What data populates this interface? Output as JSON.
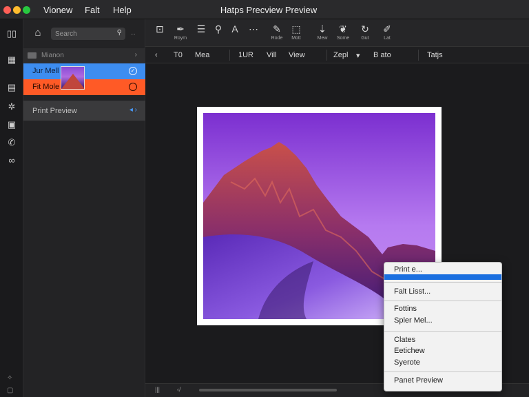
{
  "window": {
    "title": "Hatps Precview Preview",
    "menus": [
      "Vionew",
      "Falt",
      "Help"
    ]
  },
  "sidebar": {
    "search_placeholder": "Search",
    "more_glyph": "‥",
    "header_label": "Mianon",
    "items": [
      {
        "label": "Jur Mell",
        "state": "selected"
      },
      {
        "label": "Fit Mole",
        "state": "unchecked"
      },
      {
        "label": "Print Preview",
        "state": "normal"
      }
    ]
  },
  "toolbar": {
    "buttons": [
      {
        "icon": "crop-icon",
        "label": ""
      },
      {
        "icon": "pen-icon",
        "label": "Roym"
      },
      {
        "icon": "list-icon",
        "label": ""
      },
      {
        "icon": "magnify-icon",
        "label": ""
      },
      {
        "icon": "text-icon",
        "label": ""
      },
      {
        "icon": "more-icon",
        "label": ""
      },
      {
        "icon": "pencil-icon",
        "label": "Rode"
      },
      {
        "icon": "shape-icon",
        "label": "Mott"
      },
      {
        "icon": "pin-icon",
        "label": "Mew"
      },
      {
        "icon": "feather-icon",
        "label": "Some"
      },
      {
        "icon": "rotate-icon",
        "label": "Gut"
      },
      {
        "icon": "markup-icon",
        "label": "Lat"
      }
    ]
  },
  "tabs": [
    "T0",
    "Mea",
    "1UR",
    "Vill",
    "View",
    "Zepl",
    "B ato",
    "Tatjs"
  ],
  "bottom": {
    "left_icon": "|||",
    "right_icon": "‹/"
  },
  "context_menu": {
    "items": [
      "Print e...",
      "Falt Lisst...",
      "Fottins",
      "Spler Mel...",
      "Clates",
      "Eetichew",
      "Syerote",
      "Panet Preview"
    ]
  },
  "colors": {
    "selected_row": "#3d8df0",
    "orange_row": "#ff5a26",
    "menu_highlight": "#1a6fe0"
  }
}
